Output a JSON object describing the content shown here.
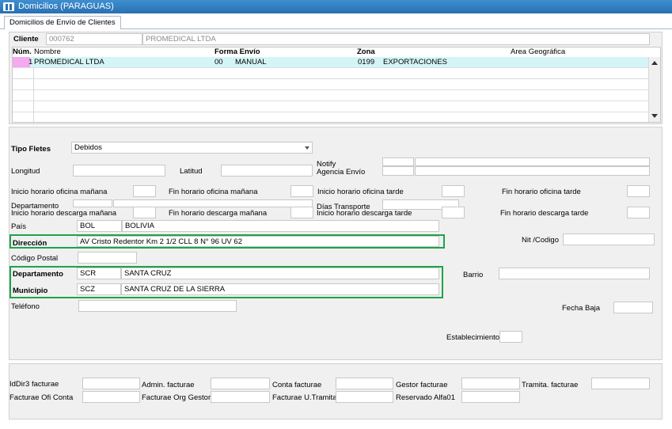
{
  "window": {
    "title": "Domicilios (PARAGUAS)"
  },
  "tabs": [
    {
      "label": "Domicilios de Envío de Clientes"
    }
  ],
  "cliente": {
    "label": "Cliente",
    "code": "000762",
    "name": "PROMEDICAL LTDA"
  },
  "grid": {
    "columns": {
      "num": "Núm.",
      "nombre": "Nombre",
      "forma_envio": "Forma Envío",
      "zona": "Zona",
      "area": "Area Geográfica"
    },
    "rows": [
      {
        "num": "1",
        "nombre": "PROMEDICAL LTDA",
        "forma_code": "00",
        "forma_desc": "MANUAL",
        "zona_code": "0199",
        "zona_desc": "EXPORTACIONES"
      }
    ]
  },
  "form": {
    "tipo_fletes": {
      "label": "Tipo Fletes",
      "value": "Debidos"
    },
    "longitud": {
      "label": "Longitud",
      "value": ""
    },
    "latitud": {
      "label": "Latitud",
      "value": ""
    },
    "notify": {
      "label": "Notify",
      "value": ""
    },
    "agencia_envio": {
      "label": "Agencia Envío",
      "value": ""
    },
    "inicio_oficina_manana": {
      "label": "Inicio horario oficina mañana",
      "value": ""
    },
    "fin_oficina_manana": {
      "label": "Fin horario oficina mañana",
      "value": ""
    },
    "inicio_oficina_tarde": {
      "label": "Inicio horario oficina tarde",
      "value": ""
    },
    "fin_oficina_tarde": {
      "label": "Fin horario oficina tarde",
      "value": ""
    },
    "departamento_hidden": {
      "label": "Departamento"
    },
    "dias_transporte": {
      "label": "Días Transporte",
      "value": ""
    },
    "inicio_descarga_manana": {
      "label": "Inicio horario descarga mañana",
      "value": ""
    },
    "fin_descarga_manana": {
      "label": "Fin horario descarga mañana",
      "value": ""
    },
    "inicio_descarga_tarde": {
      "label": "Inicio horario descarga tarde",
      "value": ""
    },
    "fin_descarga_tarde": {
      "label": "Fin horario descarga tarde",
      "value": ""
    },
    "pais": {
      "label": "País",
      "code": "BOL",
      "name": "BOLIVIA"
    },
    "direccion": {
      "label": "Dirección",
      "value": "AV Cristo Redentor Km 2  1/2  CLL 8 N° 96 UV 62"
    },
    "nit": {
      "label": "Nit /Codigo",
      "value": ""
    },
    "codigo_postal": {
      "label": "Código Postal",
      "value": ""
    },
    "departamento": {
      "label": "Departamento",
      "code": "SCR",
      "name": "SANTA CRUZ"
    },
    "barrio": {
      "label": "Barrio",
      "value": ""
    },
    "municipio": {
      "label": "Municipio",
      "code": "SCZ",
      "name": "SANTA CRUZ DE LA SIERRA"
    },
    "telefono": {
      "label": "Teléfono",
      "value": ""
    },
    "fecha_baja": {
      "label": "Fecha Baja",
      "value": ""
    },
    "establecimiento": {
      "label": "Establecimiento",
      "value": ""
    }
  },
  "facturae": {
    "iddir3": {
      "label": "IdDir3 facturae",
      "value": ""
    },
    "admin": {
      "label": "Admin. facturae",
      "value": ""
    },
    "conta": {
      "label": "Conta facturae",
      "value": ""
    },
    "gestor": {
      "label": "Gestor facturae",
      "value": ""
    },
    "tramita": {
      "label": "Tramita. facturae",
      "value": ""
    },
    "ofi_conta": {
      "label": "Facturae Ofi Conta",
      "value": ""
    },
    "org_gestor": {
      "label": "Facturae Org Gestor",
      "value": ""
    },
    "u_tramita": {
      "label": "Facturae U.Tramita",
      "value": ""
    },
    "reservado": {
      "label": "Reservado Alfa01",
      "value": ""
    }
  },
  "colors": {
    "titlebar": "#2a6fb2",
    "highlight_border": "#1fa34a",
    "selected_row": "#d4f5f7",
    "row_marker": "#f5a9f0"
  }
}
